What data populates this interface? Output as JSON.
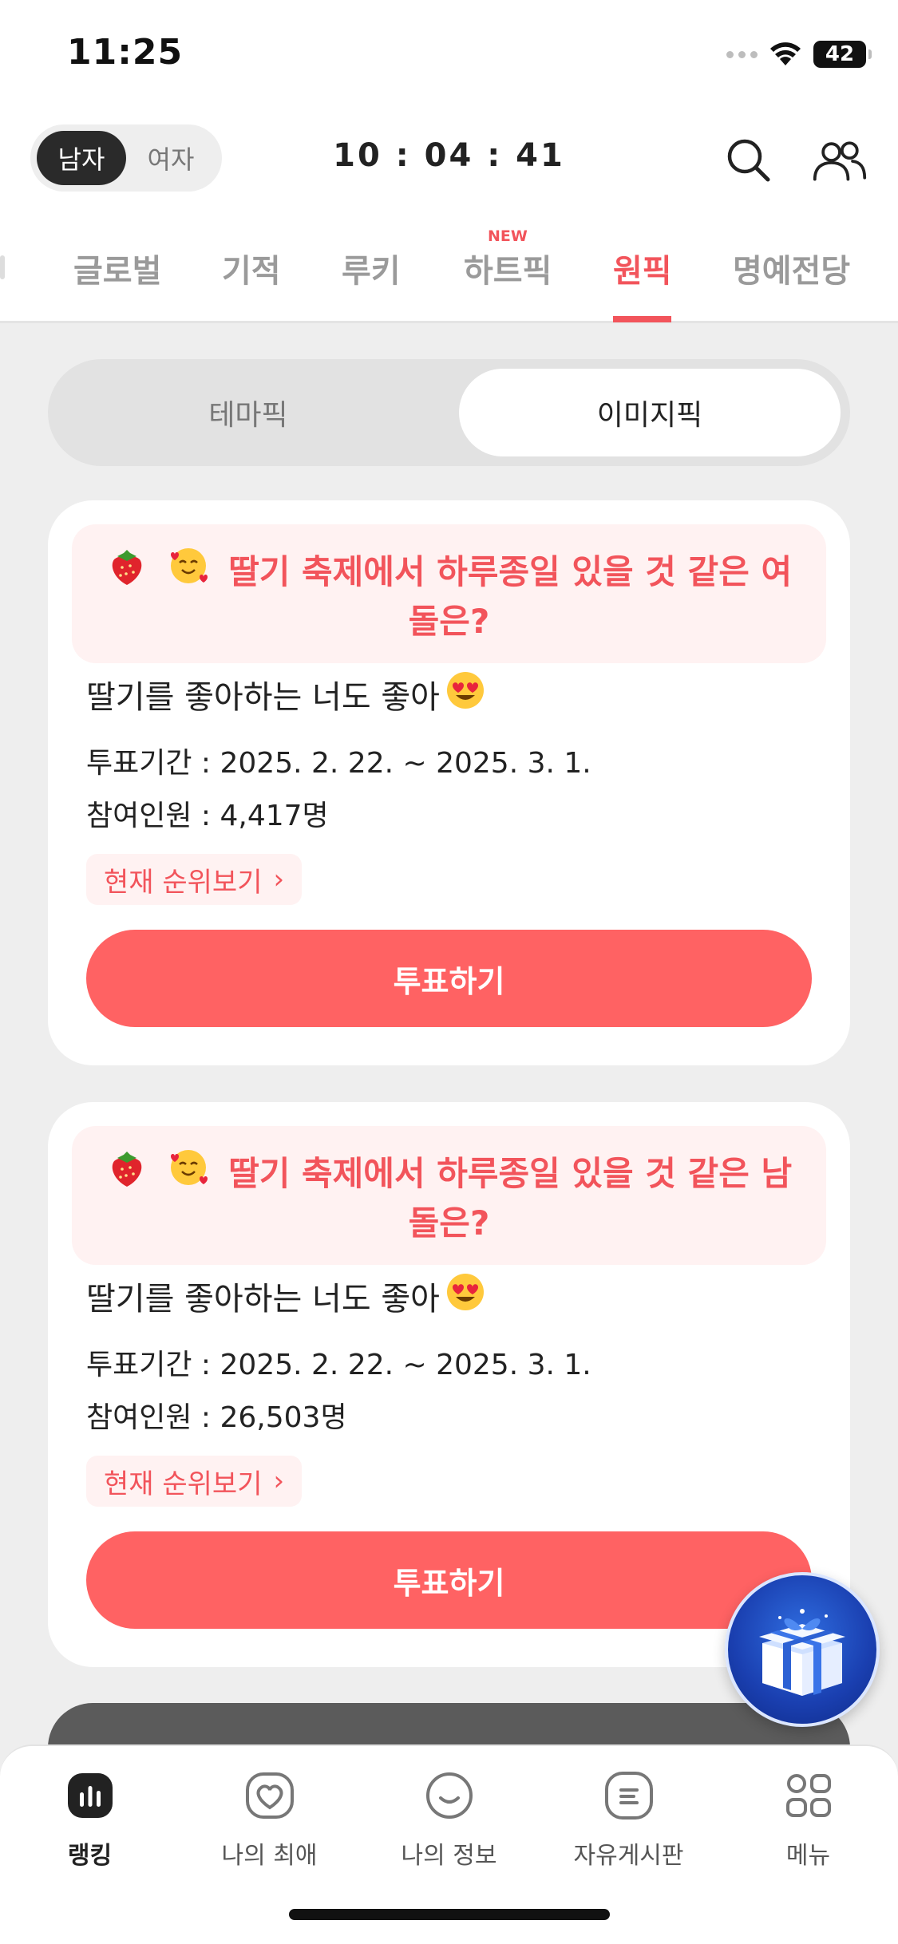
{
  "status": {
    "time": "11:25",
    "battery": "42"
  },
  "header": {
    "gender": {
      "male": "남자",
      "female": "여자",
      "selected": "male"
    },
    "timer": "10 : 04 : 41"
  },
  "tabs": {
    "items": [
      {
        "label": "글로벌"
      },
      {
        "label": "기적"
      },
      {
        "label": "루키"
      },
      {
        "label": "하트픽",
        "badge": "NEW"
      },
      {
        "label": "원픽",
        "active": true
      },
      {
        "label": "명예전당"
      }
    ]
  },
  "segment": {
    "left": "테마픽",
    "right": "이미지픽",
    "selected": "right"
  },
  "cards": [
    {
      "title": "딸기 축제에서 하루종일 있을 것 같은 여돌은?",
      "subtitle": "딸기를 좋아하는 너도 좋아",
      "period": "투표기간 : 2025. 2. 22. ~ 2025. 3. 1.",
      "participants": "참여인원 : 4,417명",
      "rank_label": "현재 순위보기",
      "vote_label": "투표하기"
    },
    {
      "title": "딸기 축제에서 하루종일 있을 것 같은 남돌은?",
      "subtitle": "딸기를 좋아하는 너도 좋아",
      "period": "투표기간 : 2025. 2. 22. ~ 2025. 3. 1.",
      "participants": "참여인원 : 26,503명",
      "rank_label": "현재 순위보기",
      "vote_label": "투표하기"
    }
  ],
  "bottom_nav": {
    "items": [
      {
        "label": "랭킹",
        "icon": "ranking-icon",
        "active": true
      },
      {
        "label": "나의 최애",
        "icon": "heart-icon"
      },
      {
        "label": "나의 정보",
        "icon": "smile-icon"
      },
      {
        "label": "자유게시판",
        "icon": "board-icon"
      },
      {
        "label": "메뉴",
        "icon": "menu-grid-icon"
      }
    ]
  },
  "colors": {
    "accent": "#f2545b",
    "vote_button": "#ff6263",
    "title_bg": "#fff2f2"
  }
}
